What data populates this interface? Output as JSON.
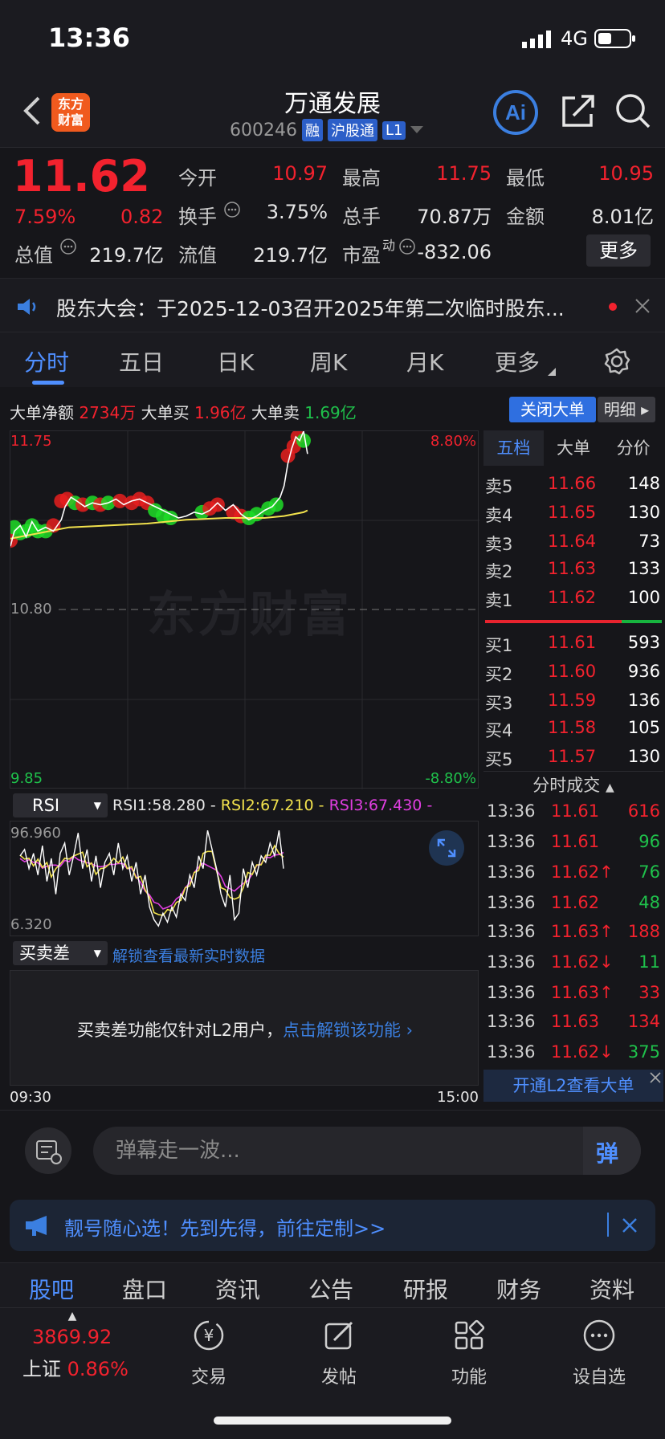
{
  "status_bar": {
    "time": "13:36",
    "network": "4G"
  },
  "header": {
    "logo_text_line1": "东方",
    "logo_text_line2": "财富",
    "stock_name": "万通发展",
    "stock_code": "600246",
    "tags": [
      "融",
      "沪股通",
      "L1"
    ]
  },
  "quote": {
    "price": "11.62",
    "pct_change": "7.59%",
    "change": "0.82",
    "open_label": "今开",
    "open": "10.97",
    "high_label": "最高",
    "high": "11.75",
    "low_label": "最低",
    "low": "10.95",
    "turnover_label": "换手",
    "turnover": "3.75%",
    "volume_label": "总手",
    "volume": "70.87万",
    "amount_label": "金额",
    "amount": "8.01亿",
    "mktcap_label": "总值",
    "mktcap": "219.7亿",
    "float_label": "流值",
    "float": "219.7亿",
    "pe_label": "市盈",
    "pe_sup": "动",
    "pe": "-832.06",
    "more_label": "更多"
  },
  "announcement": {
    "text": "股东大会：于2025-12-03召开2025年第二次临时股东..."
  },
  "tabs": [
    "分时",
    "五日",
    "日K",
    "周K",
    "月K",
    "更多"
  ],
  "big_order": {
    "net_label": "大单净额",
    "net": "2734万",
    "buy_label": "大单买",
    "buy": "1.96亿",
    "sell_label": "大单卖",
    "sell": "1.69亿",
    "close_btn": "关闭大单",
    "detail_btn": "明细"
  },
  "chart": {
    "watermark": "东方财富",
    "top_price": "11.75",
    "top_pct": "8.80%",
    "mid_price": "10.80",
    "bottom_price": "9.85",
    "bottom_pct": "-8.80%",
    "price_color": "#ffffff",
    "avg_color": "#f2e24d"
  },
  "order_book": {
    "tabs": [
      "五档",
      "大单",
      "分价"
    ],
    "asks": [
      {
        "label": "卖5",
        "price": "11.66",
        "vol": "148"
      },
      {
        "label": "卖4",
        "price": "11.65",
        "vol": "130"
      },
      {
        "label": "卖3",
        "price": "11.64",
        "vol": "73"
      },
      {
        "label": "卖2",
        "price": "11.63",
        "vol": "133"
      },
      {
        "label": "卖1",
        "price": "11.62",
        "vol": "100"
      }
    ],
    "bids": [
      {
        "label": "买1",
        "price": "11.61",
        "vol": "593"
      },
      {
        "label": "买2",
        "price": "11.60",
        "vol": "936"
      },
      {
        "label": "买3",
        "price": "11.59",
        "vol": "136"
      },
      {
        "label": "买4",
        "price": "11.58",
        "vol": "105"
      },
      {
        "label": "买5",
        "price": "11.57",
        "vol": "130"
      }
    ],
    "ticks_title": "分时成交",
    "ticks": [
      {
        "time": "13:36",
        "price": "11.61",
        "vol": "616",
        "vol_color": "red"
      },
      {
        "time": "13:36",
        "price": "11.61",
        "vol": "96",
        "vol_color": "green"
      },
      {
        "time": "13:36",
        "price": "11.62↑",
        "vol": "76",
        "vol_color": "green"
      },
      {
        "time": "13:36",
        "price": "11.62",
        "vol": "48",
        "vol_color": "green"
      },
      {
        "time": "13:36",
        "price": "11.63↑",
        "vol": "188",
        "vol_color": "red"
      },
      {
        "time": "13:36",
        "price": "11.62↓",
        "vol": "11",
        "vol_color": "green"
      },
      {
        "time": "13:36",
        "price": "11.63↑",
        "vol": "33",
        "vol_color": "red"
      },
      {
        "time": "13:36",
        "price": "11.63",
        "vol": "134",
        "vol_color": "red"
      },
      {
        "time": "13:36",
        "price": "11.62↓",
        "vol": "375",
        "vol_color": "green"
      }
    ],
    "l2_banner": "开通L2查看大单"
  },
  "rsi": {
    "select": "RSI",
    "rsi1": "RSI1:58.280 -",
    "rsi2": "RSI2:67.210 -",
    "rsi3": "RSI3:67.430 -",
    "max": "96.960",
    "min": "6.320"
  },
  "buy_sell_diff": {
    "select": "买卖差",
    "unlock_link": "解锁查看最新实时数据",
    "msg": "买卖差功能仅针对L2用户，",
    "msg_link": "点击解锁该功能"
  },
  "time_axis": {
    "start": "09:30",
    "end": "15:00"
  },
  "comment": {
    "placeholder": "弹幕走一波...",
    "danmu": "弹"
  },
  "promo": {
    "text": "靓号随心选！先到先得，前往定制>>"
  },
  "section_tabs": [
    "股吧",
    "盘口",
    "资讯",
    "公告",
    "研报",
    "财务",
    "资料"
  ],
  "bottom_nav": {
    "index_value": "3869.92",
    "index_name": "上证",
    "index_pct": "0.86%",
    "items": [
      "交易",
      "发帖",
      "功能",
      "设自选"
    ]
  }
}
